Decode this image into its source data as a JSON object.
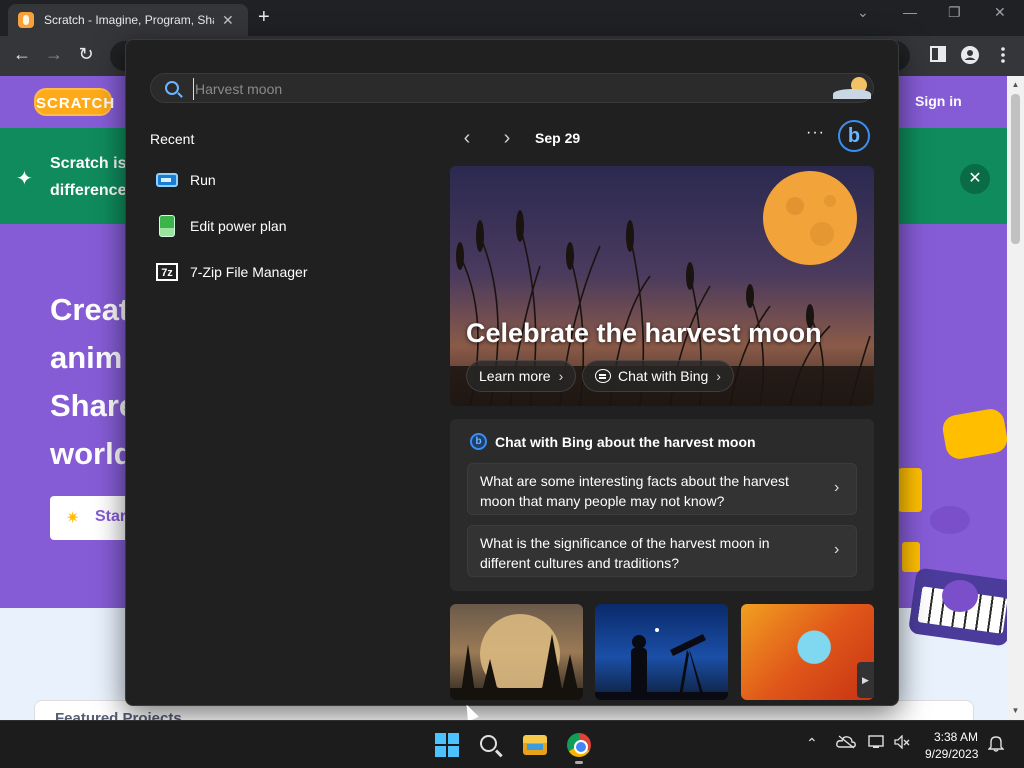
{
  "browser": {
    "tab_title": "Scratch - Imagine, Program, Share",
    "tab_close": "✕",
    "new_tab": "+",
    "back": "←",
    "forward": "→",
    "reload": "↻",
    "window_min": "—",
    "window_restore": "❐",
    "window_close": "✕",
    "tab_search": "⌄"
  },
  "scratch": {
    "logo": "SCRATCH",
    "sign_in": "Sign in",
    "banner_line1": "Scratch is",
    "banner_line2": "difference",
    "banner_close": "✕",
    "hero_lines": [
      "Creat",
      "anim",
      "Share",
      "world"
    ],
    "start_label": "Star",
    "featured_label": "Featured Projects"
  },
  "search": {
    "placeholder": "Harvest moon",
    "recent_title": "Recent",
    "recent_items": [
      {
        "label": "Run"
      },
      {
        "label": "Edit power plan"
      },
      {
        "label": "7-Zip File Manager"
      }
    ],
    "icon_7z": "7z",
    "date": "Sep 29",
    "more": "···",
    "bing_letter": "b",
    "hero_title": "Celebrate the harvest moon",
    "learn_more": "Learn more",
    "chat_with_bing": "Chat with Bing",
    "chat_card_title": "Chat with Bing about the harvest moon",
    "suggestions": [
      "What are some interesting facts about the harvest moon that many people may not know?",
      "What is the significance of the harvest moon in different cultures and traditions?"
    ]
  },
  "taskbar": {
    "time": "3:38 AM",
    "date": "9/29/2023"
  },
  "colors": {
    "accent": "#4cc2ff",
    "scratch_purple": "#855cd6",
    "scratch_green": "#0f8b5d",
    "flyout_bg": "#202020",
    "moon": "#f2a43a"
  }
}
